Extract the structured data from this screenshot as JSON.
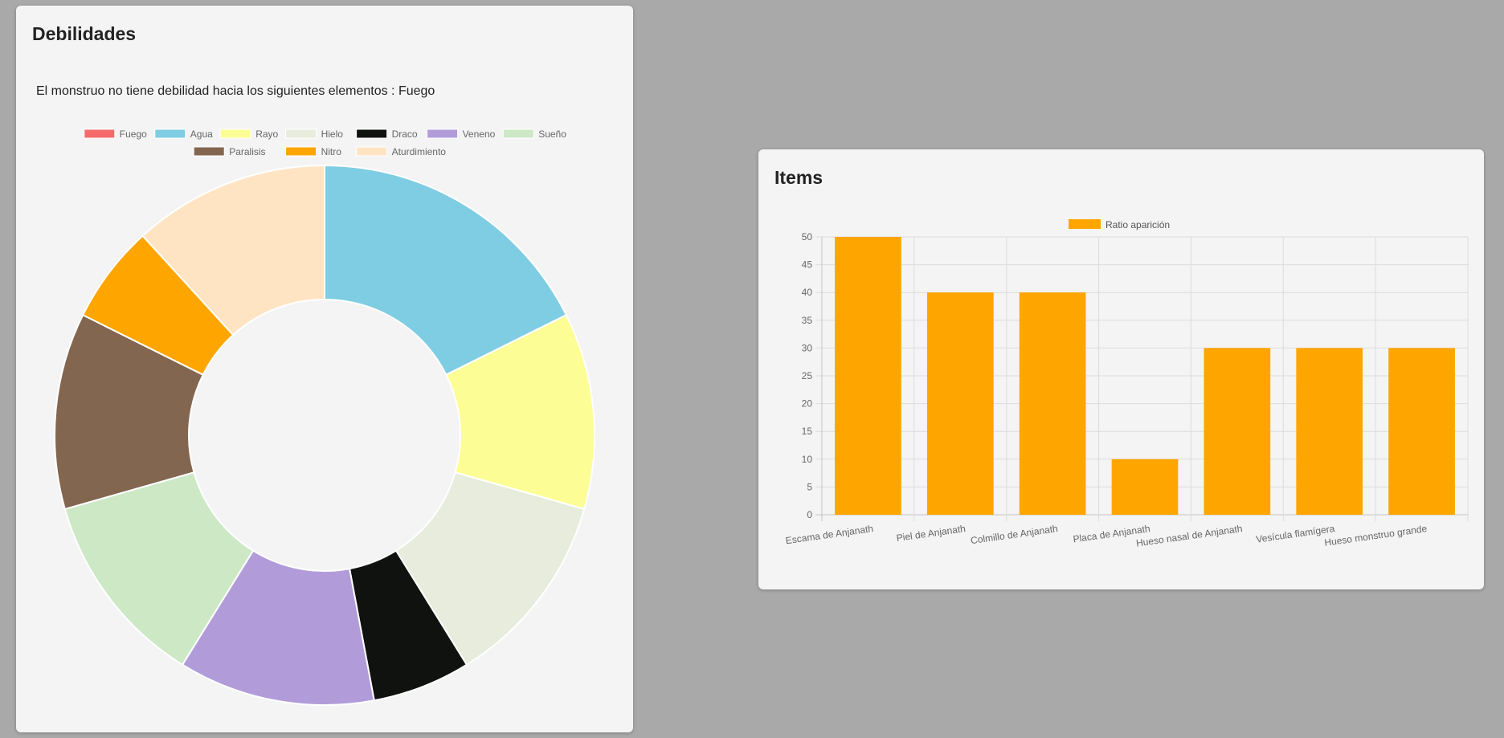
{
  "weaknesses_card": {
    "title": "Debilidades",
    "message": "El monstruo no tiene debilidad hacia los siguientes elementos : Fuego"
  },
  "items_card": {
    "title": "Items"
  },
  "chart_data": [
    {
      "type": "pie",
      "variant": "doughnut",
      "legend_position": "top",
      "labels": [
        "Fuego",
        "Agua",
        "Rayo",
        "Hielo",
        "Draco",
        "Veneno",
        "Sueño",
        "Paralisis",
        "Nitro",
        "Aturdimiento"
      ],
      "values": [
        0,
        3,
        2,
        2,
        1,
        2,
        2,
        2,
        1,
        2
      ],
      "colors": [
        "#f56a6a",
        "#7fcde2",
        "#fdfd96",
        "#e8ecdc",
        "#0f120e",
        "#b19cd9",
        "#cce8c5",
        "#83664f",
        "#ffa500",
        "#ffe4c4"
      ]
    },
    {
      "type": "bar",
      "legend_position": "top",
      "categories": [
        "Escama de Anjanath",
        "Piel de Anjanath",
        "Colmillo de Anjanath",
        "Placa de Anjanath",
        "Hueso nasal de Anjanath",
        "Vesícula flamígera",
        "Hueso monstruo grande"
      ],
      "series": [
        {
          "name": "Ratio aparición",
          "values": [
            50,
            40,
            40,
            10,
            30,
            30,
            30
          ],
          "color": "#ffa500"
        }
      ],
      "ylim": [
        0,
        50
      ],
      "yticks": [
        0,
        5,
        10,
        15,
        20,
        25,
        30,
        35,
        40,
        45,
        50
      ],
      "grid": true
    }
  ]
}
